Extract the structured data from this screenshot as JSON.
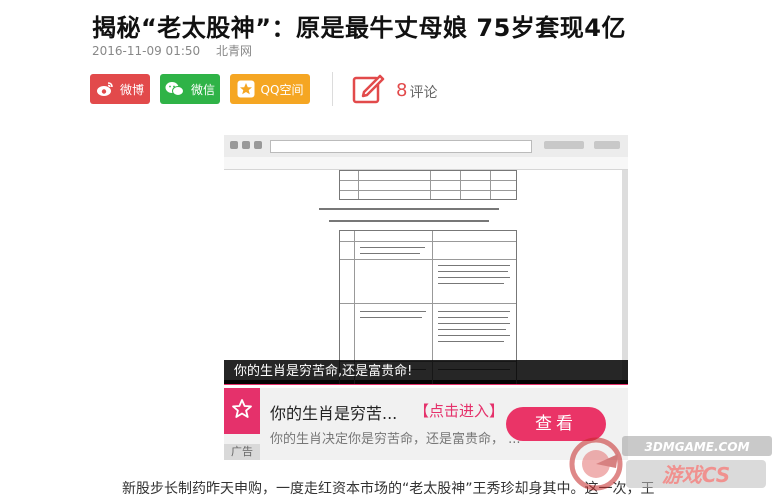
{
  "article": {
    "title": "揭秘“老太股神”：原是最牛丈母娘 75岁套现4亿",
    "date": "2016-11-09 01:50",
    "source": "北青网"
  },
  "share": {
    "weibo": "微博",
    "weixin": "微信",
    "qzone": "QQ空间"
  },
  "comments": {
    "count": "8",
    "label": "评论"
  },
  "media": {
    "caption": "你的生肖是穷苦命,还是富贵命!"
  },
  "ad": {
    "title": "你的生肖是穷苦...",
    "cta_link": "【点击进入】",
    "desc": "你的生肖决定你是穷苦命，还是富贵命，  ...",
    "button": "查看",
    "tag": "广告"
  },
  "body": {
    "first_line": "新股步长制药昨天申购，一度走红资本市场的“老太股神”王秀珍却身其中。这一次，王"
  },
  "watermark": {
    "top": "3DMGAME.COM",
    "bottom": "游戏CS"
  },
  "colors": {
    "weibo": "#e24a4b",
    "weixin": "#2fb347",
    "qzone": "#f5a623",
    "accent": "#e5316b"
  }
}
